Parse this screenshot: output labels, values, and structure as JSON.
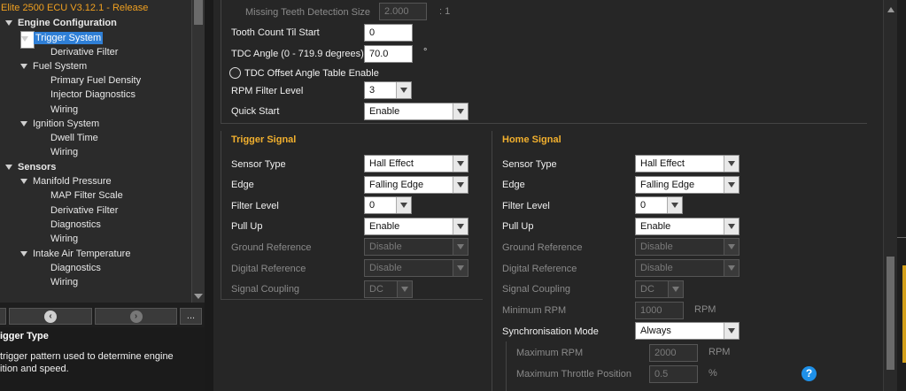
{
  "tree": {
    "app_title": "Elite 2500 ECU V3.12.1 - Release",
    "items": [
      {
        "label": "Engine Configuration",
        "kind": "cat"
      },
      {
        "label": "Trigger System",
        "kind": "sub",
        "selected": true
      },
      {
        "label": "Derivative Filter",
        "kind": "leaf"
      },
      {
        "label": "Fuel System",
        "kind": "sub"
      },
      {
        "label": "Primary Fuel Density",
        "kind": "leaf"
      },
      {
        "label": "Injector Diagnostics",
        "kind": "leaf"
      },
      {
        "label": "Wiring",
        "kind": "leaf"
      },
      {
        "label": "Ignition System",
        "kind": "sub"
      },
      {
        "label": "Dwell Time",
        "kind": "leaf"
      },
      {
        "label": "Wiring",
        "kind": "leaf"
      },
      {
        "label": "Sensors",
        "kind": "cat"
      },
      {
        "label": "Manifold Pressure",
        "kind": "sub"
      },
      {
        "label": "MAP Filter Scale",
        "kind": "leaf"
      },
      {
        "label": "Derivative Filter",
        "kind": "leaf"
      },
      {
        "label": "Diagnostics",
        "kind": "leaf"
      },
      {
        "label": "Wiring",
        "kind": "leaf"
      },
      {
        "label": "Intake Air Temperature",
        "kind": "sub"
      },
      {
        "label": "Diagnostics",
        "kind": "leaf"
      },
      {
        "label": "Wiring",
        "kind": "leaf"
      }
    ]
  },
  "nav": {
    "more_label": "..."
  },
  "help": {
    "title": "igger Type",
    "description": "trigger pattern used to determine engine\nition and speed."
  },
  "general": {
    "missing_teeth_label": "Missing Teeth Detection Size",
    "missing_teeth_value": "2.000",
    "missing_teeth_unit": ": 1",
    "tooth_count_label": "Tooth Count Til Start",
    "tooth_count_value": "0",
    "tdc_angle_label": "TDC Angle (0 - 719.9 degrees)",
    "tdc_angle_value": "70.0",
    "tdc_angle_unit": "°",
    "tdc_offset_label": "TDC Offset Angle Table Enable",
    "rpm_filter_label": "RPM Filter Level",
    "rpm_filter_value": "3",
    "quick_start_label": "Quick Start",
    "quick_start_value": "Enable"
  },
  "trigger_signal": {
    "header": "Trigger Signal",
    "sensor_type_label": "Sensor Type",
    "sensor_type_value": "Hall Effect",
    "edge_label": "Edge",
    "edge_value": "Falling Edge",
    "filter_level_label": "Filter Level",
    "filter_level_value": "0",
    "pull_up_label": "Pull Up",
    "pull_up_value": "Enable",
    "ground_ref_label": "Ground Reference",
    "ground_ref_value": "Disable",
    "digital_ref_label": "Digital Reference",
    "digital_ref_value": "Disable",
    "coupling_label": "Signal Coupling",
    "coupling_value": "DC"
  },
  "home_signal": {
    "header": "Home Signal",
    "sensor_type_label": "Sensor Type",
    "sensor_type_value": "Hall Effect",
    "edge_label": "Edge",
    "edge_value": "Falling Edge",
    "filter_level_label": "Filter Level",
    "filter_level_value": "0",
    "pull_up_label": "Pull Up",
    "pull_up_value": "Enable",
    "ground_ref_label": "Ground Reference",
    "ground_ref_value": "Disable",
    "digital_ref_label": "Digital Reference",
    "digital_ref_value": "Disable",
    "coupling_label": "Signal Coupling",
    "coupling_value": "DC",
    "min_rpm_label": "Minimum RPM",
    "min_rpm_value": "1000",
    "min_rpm_unit": "RPM",
    "sync_mode_label": "Synchronisation Mode",
    "sync_mode_value": "Always",
    "max_rpm_label": "Maximum RPM",
    "max_rpm_value": "2000",
    "max_rpm_unit": "RPM",
    "max_throttle_label": "Maximum Throttle Position",
    "max_throttle_value": "0.5",
    "max_throttle_unit": "%"
  },
  "help_icon": "?",
  "colors": {
    "accent": "#f2b02e",
    "selection": "#2f7fd6",
    "help_icon": "#1e90e8"
  }
}
